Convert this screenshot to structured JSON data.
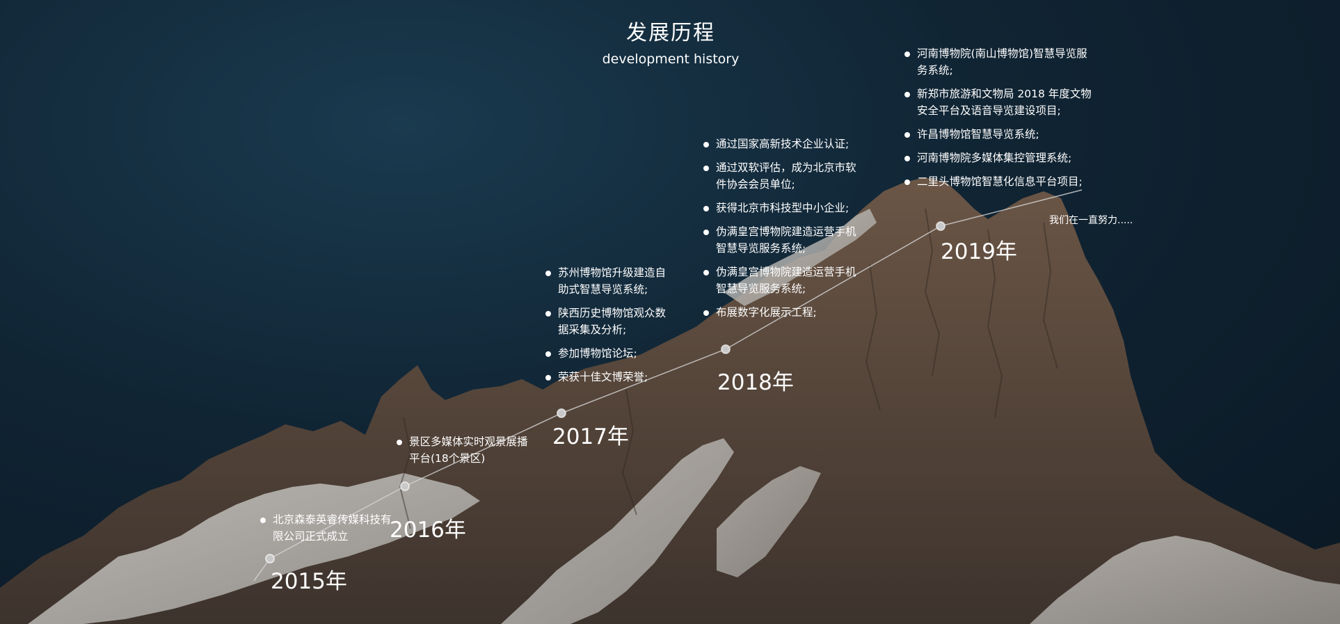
{
  "header": {
    "title": "发展历程",
    "subtitle": "development history"
  },
  "timeline": [
    {
      "year": "2015年",
      "items": [
        "北京森泰英睿传媒科技有限公司正式成立"
      ]
    },
    {
      "year": "2016年",
      "items": [
        "景区多媒体实时观景展播平台(18个景区)"
      ]
    },
    {
      "year": "2017年",
      "items": [
        "苏州博物馆升级建造自助式智慧导览系统;",
        "陕西历史博物馆观众数据采集及分析;",
        "参加博物馆论坛;",
        "荣获十佳文博荣誉;"
      ]
    },
    {
      "year": "2018年",
      "items": [
        "通过国家高新技术企业认证;",
        "通过双软评估，成为北京市软件协会会员单位;",
        "获得北京市科技型中小企业;",
        "伪满皇宫博物院建造运营手机智慧导览服务系统;",
        "伪满皇宫博物院建造运营手机智慧导览服务系统;",
        "布展数字化展示工程;"
      ]
    },
    {
      "year": "2019年",
      "items": [
        "河南博物院(南山博物馆)智慧导览服务系统;",
        "新郑市旅游和文物局 2018 年度文物安全平台及语音导览建设项目;",
        "许昌博物馆智慧导览系统;",
        "河南博物院多媒体集控管理系统;",
        "二里头博物馆智慧化信息平台项目;"
      ]
    }
  ],
  "closing_note": "我们在一直努力.....",
  "colors": {
    "sky": "#0f2231",
    "rock": "#5a4a3e",
    "snow": "#b9b7b3",
    "line": "#c9c9c9",
    "node": "#d0d0d0"
  }
}
